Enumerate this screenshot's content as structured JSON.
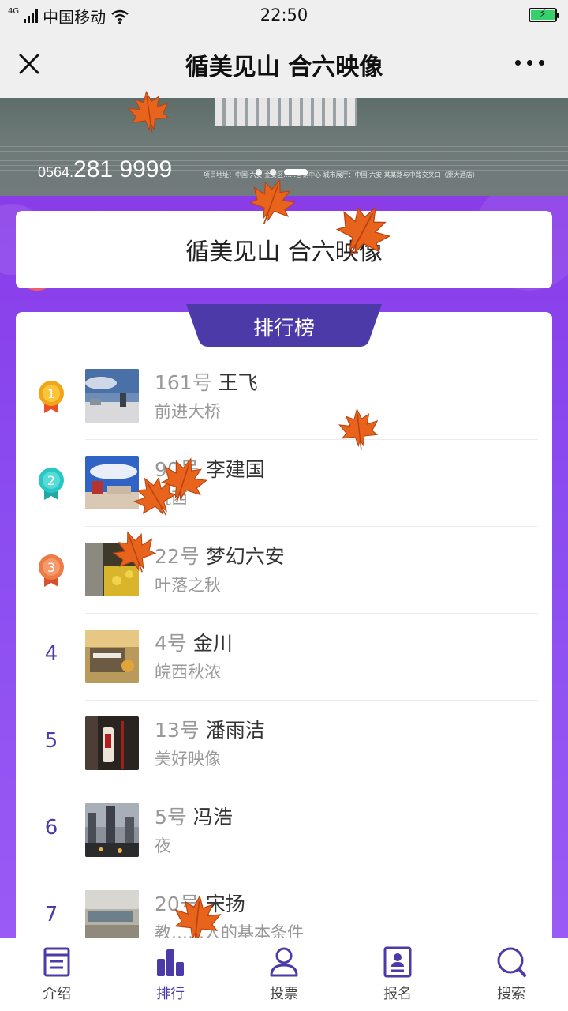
{
  "status_bar": {
    "network": "4G",
    "carrier": "中国移动",
    "time": "22:50"
  },
  "nav": {
    "title": "循美见山 合六映像"
  },
  "banner": {
    "phone_prefix": "0564.",
    "phone": "281 9999",
    "info": "项目地址：中国·六安·金安区……营销中心   城市展厅：中国·六安 某某路与中路交叉口（原大酒店）"
  },
  "title_card": {
    "text": "循美见山 合六映像"
  },
  "ranking": {
    "heading": "排行榜",
    "entries": [
      {
        "rank": "1",
        "number": "161号",
        "name": "王飞",
        "subtitle": "前进大桥",
        "badge_color": "#f3a51a"
      },
      {
        "rank": "2",
        "number": "90号",
        "name": "李建国",
        "subtitle": "皖西",
        "badge_color": "#29c7c4"
      },
      {
        "rank": "3",
        "number": "22号",
        "name": "梦幻六安",
        "subtitle": "叶落之秋",
        "badge_color": "#ee7a46"
      },
      {
        "rank": "4",
        "number": "4号",
        "name": "金川",
        "subtitle": "皖西秋浓"
      },
      {
        "rank": "5",
        "number": "13号",
        "name": "潘雨洁",
        "subtitle": "美好映像"
      },
      {
        "rank": "6",
        "number": "5号",
        "name": "冯浩",
        "subtitle": "夜"
      },
      {
        "rank": "7",
        "number": "20号",
        "name": "宋扬",
        "subtitle": "教……人的基本条件"
      }
    ]
  },
  "tab_bar": {
    "tabs": [
      {
        "label": "介绍",
        "icon": "document-icon"
      },
      {
        "label": "排行",
        "icon": "bar-chart-icon"
      },
      {
        "label": "投票",
        "icon": "user-icon"
      },
      {
        "label": "报名",
        "icon": "id-card-icon"
      },
      {
        "label": "搜索",
        "icon": "search-icon"
      }
    ],
    "active": "排行"
  },
  "colors": {
    "primary": "#4b3aa8",
    "purple_bg": "#8a3ce8",
    "leaf": "#e8641c"
  }
}
